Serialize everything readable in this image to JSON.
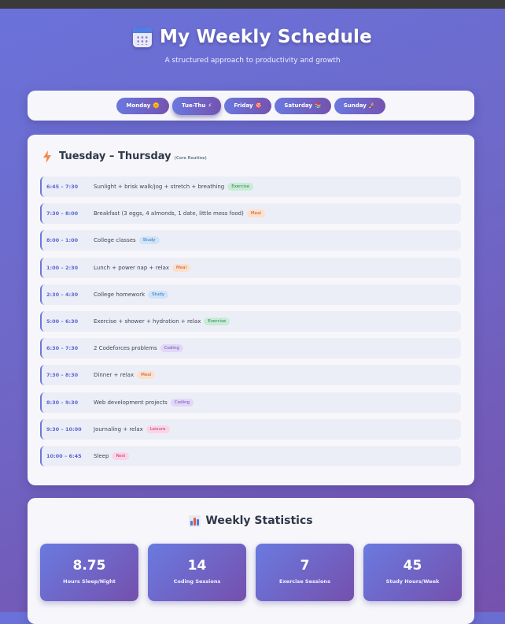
{
  "header": {
    "title": "My Weekly Schedule",
    "subtitle": "A structured approach to productivity and growth",
    "icon": "calendar-icon"
  },
  "tabs": [
    {
      "label": "Monday",
      "emoji": "🌞",
      "active": false
    },
    {
      "label": "Tue-Thu",
      "emoji": "⚡",
      "active": true
    },
    {
      "label": "Friday",
      "emoji": "🎯",
      "active": false
    },
    {
      "label": "Saturday",
      "emoji": "📚",
      "active": false
    },
    {
      "label": "Sunday",
      "emoji": "🚀",
      "active": false
    }
  ],
  "schedule": {
    "title": "Tuesday – Thursday",
    "note": "(Core Routine)",
    "icon": "lightning-icon",
    "rows": [
      {
        "time": "6:45 – 7:30",
        "activity": "Sunlight + brisk walk/jog + stretch + breathing",
        "tag": "Exercise",
        "tag_type": "exercise"
      },
      {
        "time": "7:30 – 8:00",
        "activity": "Breakfast (3 eggs, 4 almonds, 1 date, little mess food)",
        "tag": "Meal",
        "tag_type": "meal"
      },
      {
        "time": "8:00 – 1:00",
        "activity": "College classes",
        "tag": "Study",
        "tag_type": "study"
      },
      {
        "time": "1:00 – 2:30",
        "activity": "Lunch + power nap + relax",
        "tag": "Meal",
        "tag_type": "meal"
      },
      {
        "time": "2:30 – 4:30",
        "activity": "College homework",
        "tag": "Study",
        "tag_type": "study"
      },
      {
        "time": "5:00 – 6:30",
        "activity": "Exercise + shower + hydration + relax",
        "tag": "Exercise",
        "tag_type": "exercise"
      },
      {
        "time": "6:30 – 7:30",
        "activity": "2 Codeforces problems",
        "tag": "Coding",
        "tag_type": "coding"
      },
      {
        "time": "7:30 – 8:30",
        "activity": "Dinner + relax",
        "tag": "Meal",
        "tag_type": "meal"
      },
      {
        "time": "8:30 – 9:30",
        "activity": "Web development projects",
        "tag": "Coding",
        "tag_type": "coding"
      },
      {
        "time": "9:30 – 10:00",
        "activity": "Journaling + relax",
        "tag": "Leisure",
        "tag_type": "leisure"
      },
      {
        "time": "10:00 – 6:45",
        "activity": "Sleep",
        "tag": "Rest",
        "tag_type": "rest"
      }
    ]
  },
  "stats": {
    "title": "Weekly Statistics",
    "icon": "bar-chart-icon",
    "items": [
      {
        "value": "8.75",
        "label": "Hours Sleep/Night"
      },
      {
        "value": "14",
        "label": "Coding Sessions"
      },
      {
        "value": "7",
        "label": "Exercise Sessions"
      },
      {
        "value": "45",
        "label": "Study Hours/Week"
      }
    ]
  }
}
